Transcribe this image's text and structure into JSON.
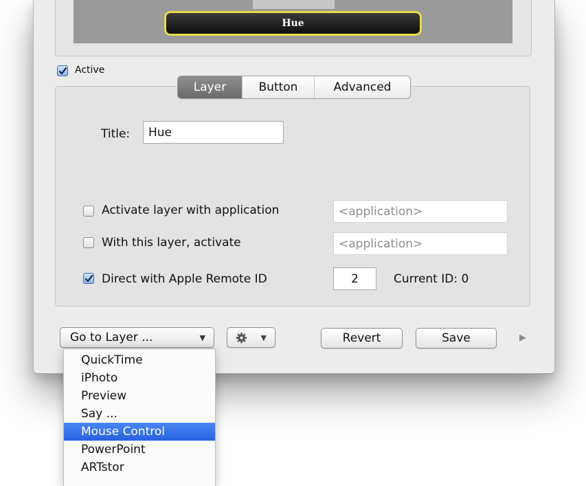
{
  "preview": {
    "layer_title": "Hue"
  },
  "active": {
    "label": "Active",
    "checked": true
  },
  "tabs": [
    {
      "label": "Layer",
      "selected": true
    },
    {
      "label": "Button",
      "selected": false
    },
    {
      "label": "Advanced",
      "selected": false
    }
  ],
  "layer_form": {
    "title_label": "Title:",
    "title_value": "Hue",
    "activate_with_app": {
      "label": "Activate layer with application",
      "checked": false,
      "placeholder": "<application>"
    },
    "with_layer_activate": {
      "label": "With this layer, activate",
      "checked": false,
      "placeholder": "<application>"
    },
    "direct_remote": {
      "label": "Direct with Apple Remote ID",
      "checked": true,
      "value": "2"
    },
    "current_id_text": "Current ID: 0"
  },
  "footer": {
    "goto_label": "Go to Layer ...",
    "revert_label": "Revert",
    "save_label": "Save"
  },
  "goto_menu": {
    "items": [
      "QuickTime",
      "iPhoto",
      "Preview",
      "Say ...",
      "Mouse Control",
      "PowerPoint",
      "ARTstor"
    ],
    "highlighted_index": 4
  },
  "colors": {
    "selection": "#2f6fe6",
    "highlight_border": "#e4dd4a"
  },
  "icons": {
    "checkmark": "checkmark-icon",
    "gear": "gear-icon",
    "dropdown": "triangle-down-icon",
    "disclosure": "triangle-right-icon"
  }
}
